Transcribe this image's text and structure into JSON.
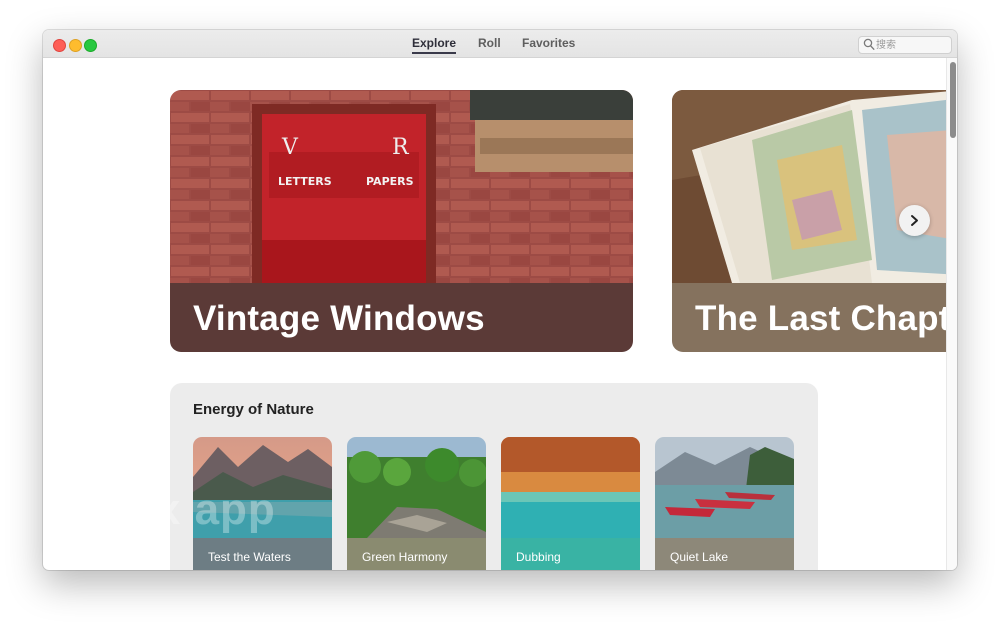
{
  "nav": {
    "tabs": [
      {
        "label": "Explore",
        "active": true
      },
      {
        "label": "Roll",
        "active": false
      },
      {
        "label": "Favorites",
        "active": false
      }
    ]
  },
  "search": {
    "placeholder": "搜索",
    "value": ""
  },
  "features": [
    {
      "title": "Vintage Windows",
      "bar_color": "#5b3a37"
    },
    {
      "title": "The Last Chapter",
      "bar_color": "#85725e"
    }
  ],
  "collection": {
    "title": "Energy of Nature",
    "items": [
      {
        "label": "Test the Waters",
        "bar_color": "#6d7d84"
      },
      {
        "label": "Green Harmony",
        "bar_color": "#8a8b70"
      },
      {
        "label": "Dubbing",
        "bar_color": "#39b3a4"
      },
      {
        "label": "Quiet Lake",
        "bar_color": "#8d8879"
      }
    ]
  },
  "watermark": "ox app",
  "icons": {
    "search": "search-icon",
    "next": "chevron-right-icon"
  },
  "colors": {
    "traffic_red": "#fe5f57",
    "traffic_yellow": "#febc2e",
    "traffic_green": "#28c840"
  }
}
